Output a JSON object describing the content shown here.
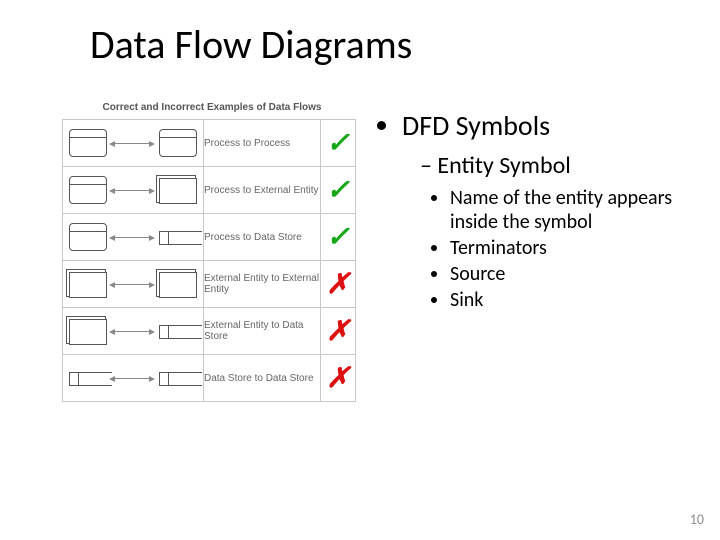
{
  "title": "Data Flow Diagrams",
  "figure": {
    "caption": "Correct and Incorrect Examples of Data Flows",
    "rows": [
      {
        "left": "process",
        "right": "process",
        "label": "Process to Process",
        "ok": true
      },
      {
        "left": "process",
        "right": "entity",
        "label": "Process to External Entity",
        "ok": true
      },
      {
        "left": "process",
        "right": "datastore",
        "label": "Process to Data Store",
        "ok": true
      },
      {
        "left": "entity",
        "right": "entity",
        "label": "External Entity to External Entity",
        "ok": false
      },
      {
        "left": "entity",
        "right": "datastore",
        "label": "External Entity to Data Store",
        "ok": false
      },
      {
        "left": "datastore",
        "right": "datastore",
        "label": "Data Store to Data Store",
        "ok": false
      }
    ]
  },
  "bullets": {
    "l1": "DFD Symbols",
    "l2": "Entity Symbol",
    "l3": [
      "Name of the entity appears inside the symbol",
      "Terminators",
      "Source",
      "Sink"
    ]
  },
  "page_number": "10"
}
